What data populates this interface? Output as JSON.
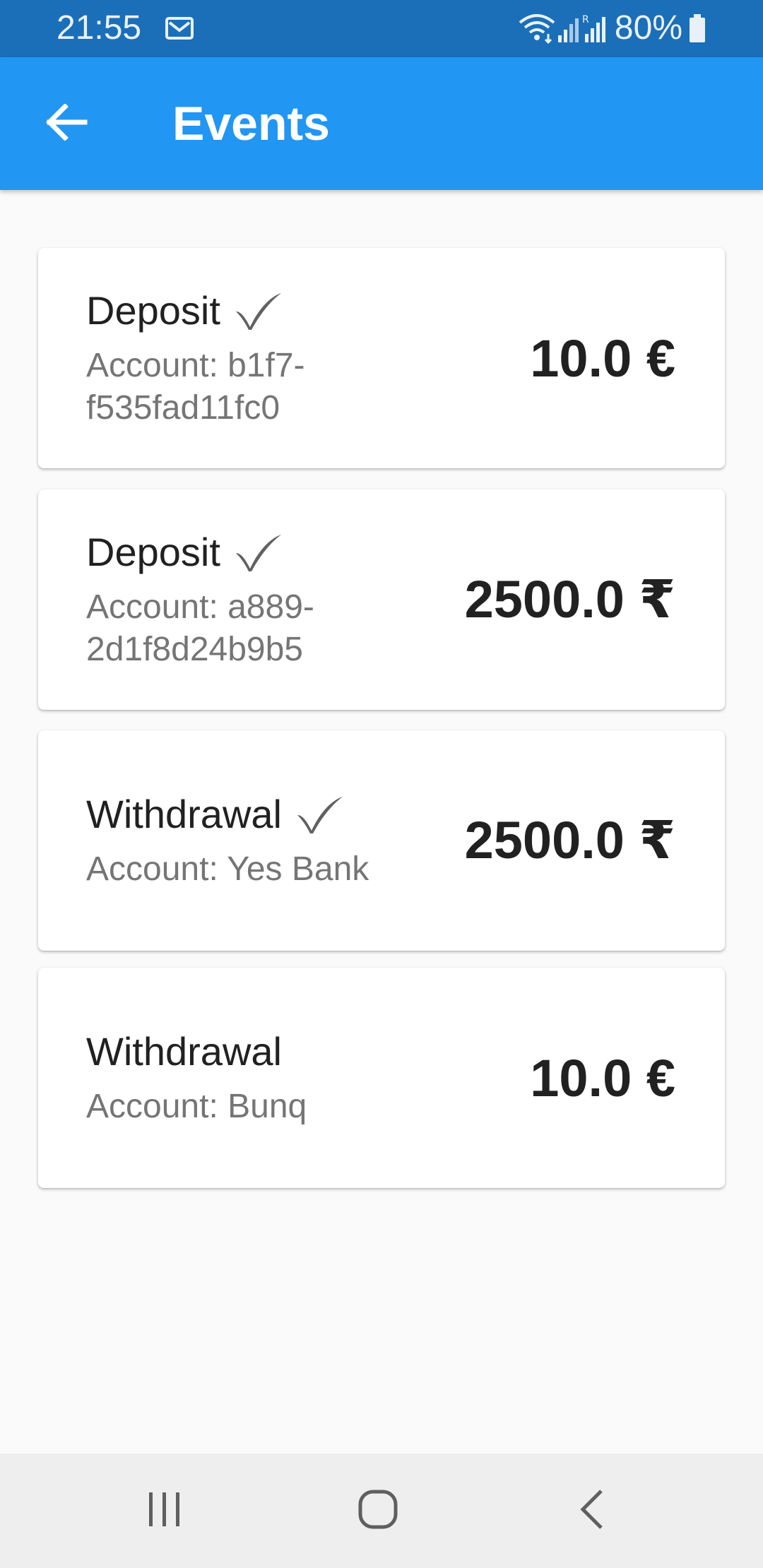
{
  "status_bar": {
    "time": "21:55",
    "battery": "80%",
    "icons": [
      "mail-icon",
      "wifi-icon",
      "signal-icon",
      "signal-roaming-icon",
      "battery-icon"
    ]
  },
  "app_bar": {
    "title": "Events",
    "back_icon": "arrow-back-icon",
    "color": "#2196f3"
  },
  "events": [
    {
      "title": "Deposit",
      "completed": true,
      "account": "Account: b1f7-f535fad11fc0",
      "amount": "10.0 €"
    },
    {
      "title": "Deposit",
      "completed": true,
      "account": "Account: a889-2d1f8d24b9b5",
      "amount": "2500.0 ₹"
    },
    {
      "title": "Withdrawal",
      "completed": true,
      "account": "Account: Yes Bank",
      "amount": "2500.0 ₹"
    },
    {
      "title": "Withdrawal",
      "completed": false,
      "account": "Account: Bunq",
      "amount": "10.0 €"
    }
  ],
  "nav_bar": {
    "icons": [
      "recent-apps-icon",
      "home-icon",
      "back-icon"
    ]
  }
}
